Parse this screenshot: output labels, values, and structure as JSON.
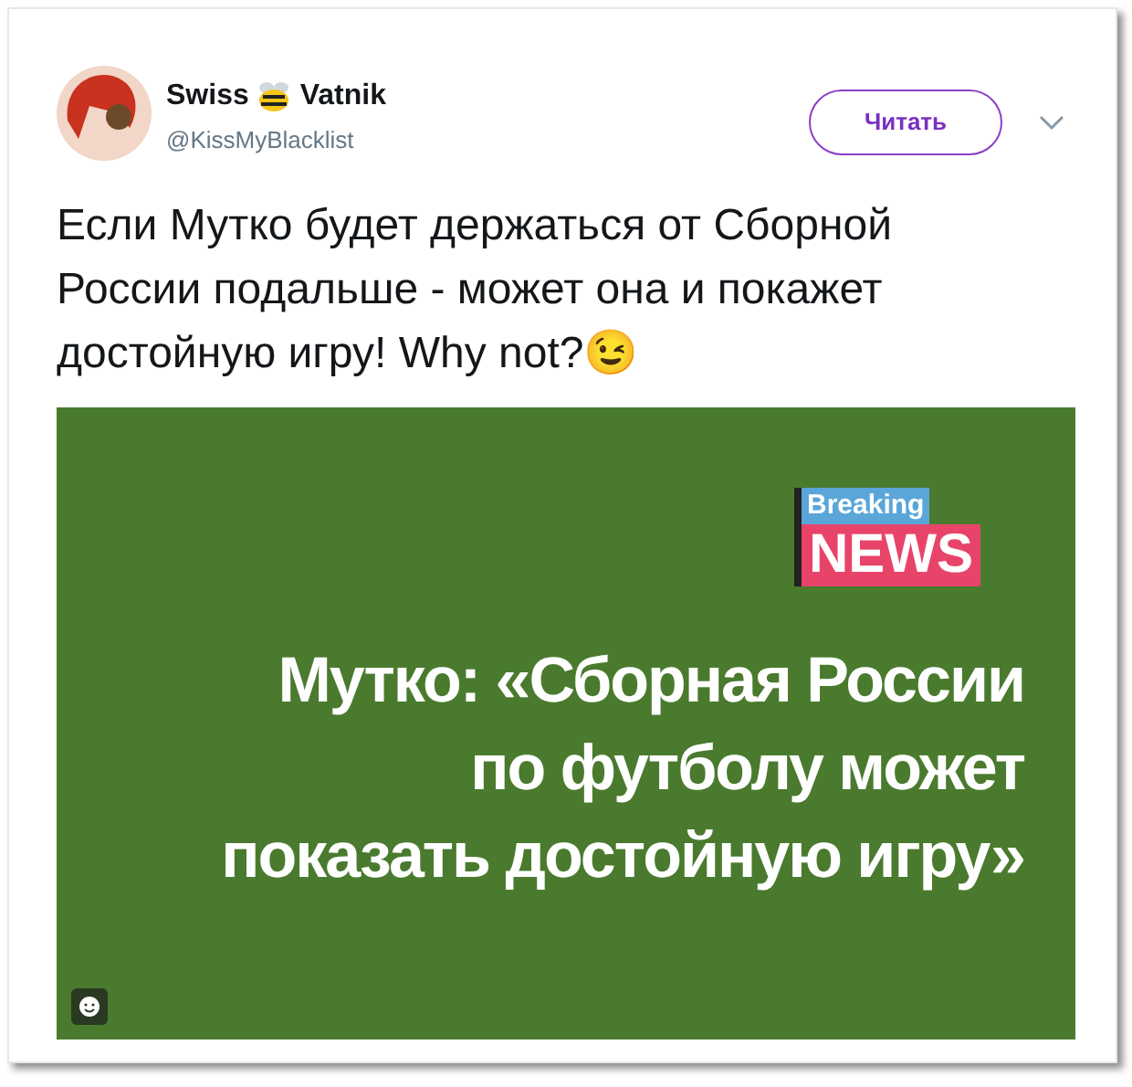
{
  "author": {
    "name_first": "Swiss",
    "name_last": "Vatnik",
    "handle": "@KissMyBlacklist"
  },
  "follow_button": {
    "label": "Читать"
  },
  "tweet_text": "Если Мутко будет держаться от Сборной России подальше - может она и покажет достойную игру! Why not?😉",
  "attached_image": {
    "badge_top": "Breaking",
    "badge_bottom": "NEWS",
    "headline_lines": [
      "Мутко: «Сборная России",
      "по футболу может",
      "показать достойную игру»"
    ]
  }
}
